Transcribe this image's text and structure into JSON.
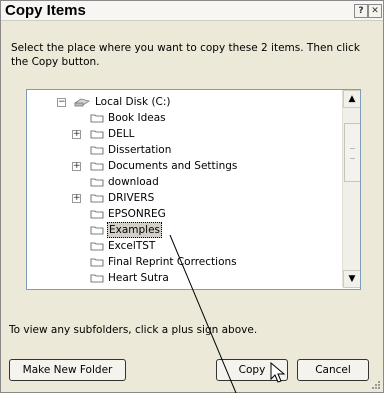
{
  "title": "Copy Items",
  "title_buttons": {
    "help": "?",
    "close": "✕"
  },
  "instruction": "Select the place where you want to copy these 2 items. Then click the Copy button.",
  "tree": {
    "root": {
      "label": "Local Disk (C:)",
      "icon": "drive-icon"
    },
    "items": [
      {
        "label": "Book Ideas",
        "expandable": false
      },
      {
        "label": "DELL",
        "expandable": true
      },
      {
        "label": "Dissertation",
        "expandable": false
      },
      {
        "label": "Documents and Settings",
        "expandable": true
      },
      {
        "label": "download",
        "expandable": false
      },
      {
        "label": "DRIVERS",
        "expandable": true
      },
      {
        "label": "EPSONREG",
        "expandable": false
      },
      {
        "label": "Examples",
        "expandable": false,
        "selected": true
      },
      {
        "label": "ExcelTST",
        "expandable": false
      },
      {
        "label": "Final Reprint Corrections",
        "expandable": false
      },
      {
        "label": "Heart Sutra",
        "expandable": false
      }
    ]
  },
  "hint": "To view any subfolders, click a plus sign above.",
  "buttons": {
    "make_new_folder": "Make New Folder",
    "copy": "Copy",
    "cancel": "Cancel"
  },
  "colors": {
    "folder": "#e8d27a",
    "selection_bg": "#d4d0c8",
    "tree_border": "#7f9db9"
  }
}
